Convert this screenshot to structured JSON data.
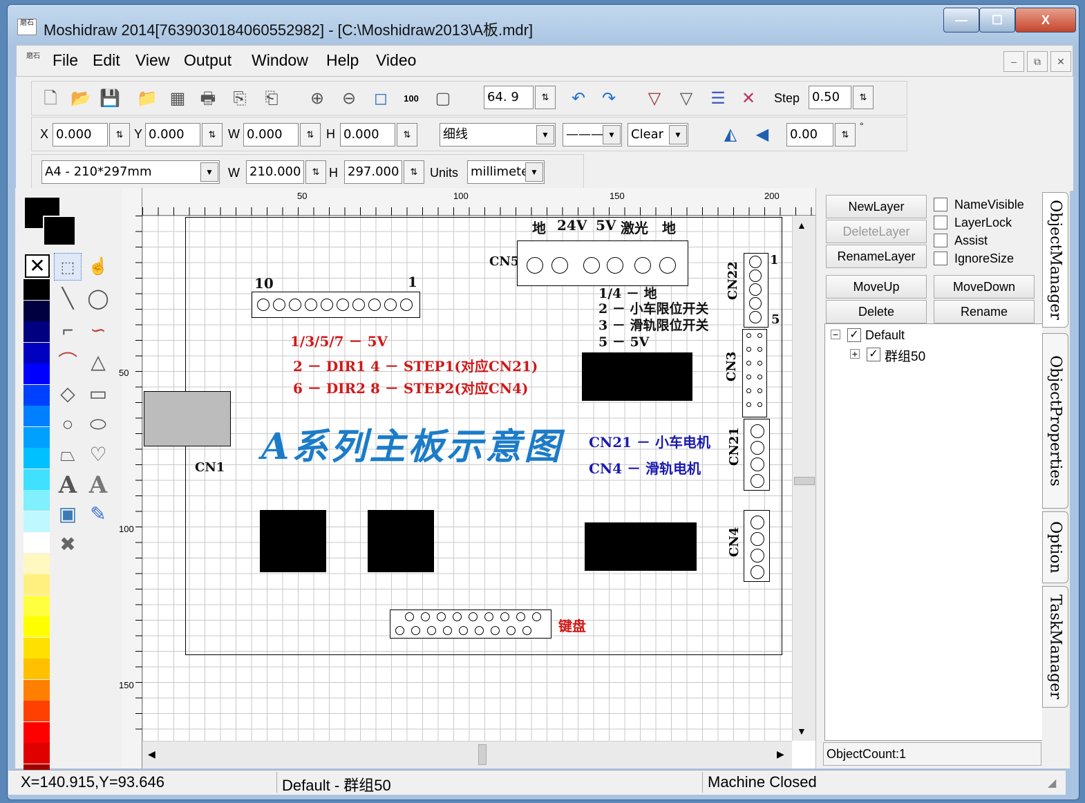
{
  "window": {
    "title": "Moshidraw 2014[7639030184060552982] - [C:\\Moshidraw2013\\A板.mdr]",
    "app_icon_text": "磨石",
    "minimize": "—",
    "maximize": "☐",
    "close": "X"
  },
  "menubar": {
    "items": [
      "File",
      "Edit",
      "View",
      "Output",
      "Window",
      "Help",
      "Video"
    ],
    "mdi_min": "–",
    "mdi_restore": "⧉",
    "mdi_close": "✕"
  },
  "toolbar1": {
    "zoom_value": "64. 9",
    "step_label": "Step",
    "step_value": "0.50"
  },
  "toolbar2": {
    "x_label": "X",
    "x_value": "0.000",
    "y_label": "Y",
    "y_value": "0.000",
    "w_label": "W",
    "w_value": "0.000",
    "h_label": "H",
    "h_value": "0.000",
    "line_type": "细线",
    "fill_mode": "Clear",
    "angle_value": "0.00",
    "angle_unit": "°"
  },
  "toolbar3": {
    "page_size": "A4 - 210*297mm",
    "w_label": "W",
    "w_value": "210.000",
    "h_label": "H",
    "h_value": "297.000",
    "units_label": "Units",
    "units_value": "millimete"
  },
  "rulers": {
    "h_ticks": [
      "50",
      "100",
      "150",
      "200"
    ],
    "v_ticks": [
      "50",
      "100",
      "150"
    ]
  },
  "palette_colors": [
    "#000000",
    "#000040",
    "#000080",
    "#0000c0",
    "#0000ff",
    "#0040ff",
    "#0080ff",
    "#00a0ff",
    "#00c0ff",
    "#40e0ff",
    "#80f0ff",
    "#c0f8ff",
    "#ffffff",
    "#fff8c0",
    "#fff080",
    "#ffff40",
    "#ffff00",
    "#ffe000",
    "#ffc000",
    "#ff8000",
    "#ff4000",
    "#ff0000",
    "#e00000",
    "#a00000"
  ],
  "drawing": {
    "cn5_pins_labels": [
      "地",
      "24V",
      "5V",
      "激光",
      "地"
    ],
    "cn5_label": "CN5",
    "header10_left": "10",
    "header10_right": "1",
    "cn22_label": "CN22",
    "cn22_pin1": "1",
    "cn22_pin5": "5",
    "cn22_notes": [
      "1/4 － 地",
      "2 － 小车限位开关",
      "3 － 滑轨限位开关",
      "5 － 5V"
    ],
    "red_notes": [
      "1/3/5/7 － 5V",
      "2 － DIR1   4 － STEP1(对应CN21)",
      "6 － DIR2   8 － STEP2(对应CN4)"
    ],
    "main_title": "A系列主板示意图",
    "cn3_label": "CN3",
    "cn21_label": "CN21",
    "cn4_label": "CN4",
    "cn1_label": "CN1",
    "blue_notes": [
      "CN21 － 小车电机",
      "CN4 － 滑轨电机"
    ],
    "keyboard_label": "键盘"
  },
  "layer_panel": {
    "new_layer": "NewLayer",
    "delete_layer": "DeleteLayer",
    "rename_layer": "RenameLayer",
    "name_visible": "NameVisible",
    "layer_lock": "LayerLock",
    "assist": "Assist",
    "ignore_size": "IgnoreSize",
    "move_up": "MoveUp",
    "move_down": "MoveDown",
    "delete": "Delete",
    "rename": "Rename",
    "tree_root": "Default",
    "tree_child": "群组50",
    "object_count": "ObjectCount:1"
  },
  "side_tabs": [
    "ObjectManager",
    "ObjectProperties",
    "Option",
    "TaskManager"
  ],
  "statusbar": {
    "coords": "X=140.915,Y=93.646",
    "selection": "Default - 群组50",
    "machine": "Machine Closed"
  }
}
